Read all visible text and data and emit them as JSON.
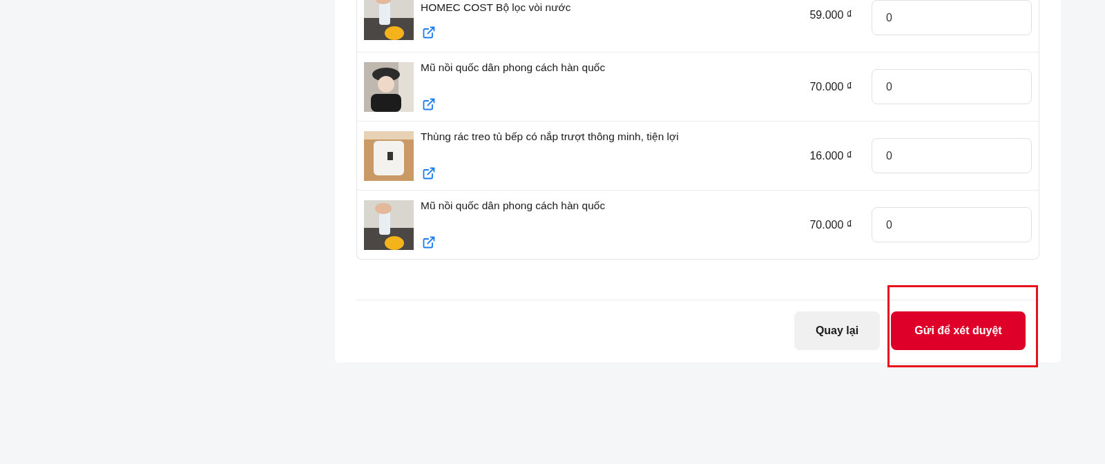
{
  "products": [
    {
      "title": "HOMEC COST Bộ lọc vòi nước",
      "price": "59.000 ₫",
      "quantity": "0"
    },
    {
      "title": "Mũ nồi quốc dân phong cách hàn quốc",
      "price": "70.000 ₫",
      "quantity": "0"
    },
    {
      "title": "Thùng rác treo tủ bếp có nắp trượt thông minh, tiện lợi",
      "price": "16.000 ₫",
      "quantity": "0"
    },
    {
      "title": "Mũ nồi quốc dân phong cách hàn quốc",
      "price": "70.000 ₫",
      "quantity": "0"
    }
  ],
  "buttons": [
    {
      "label": "Quay lại",
      "kind": "secondary"
    },
    {
      "label": "Gửi để xét duyệt",
      "kind": "primary",
      "highlighted": true
    }
  ]
}
